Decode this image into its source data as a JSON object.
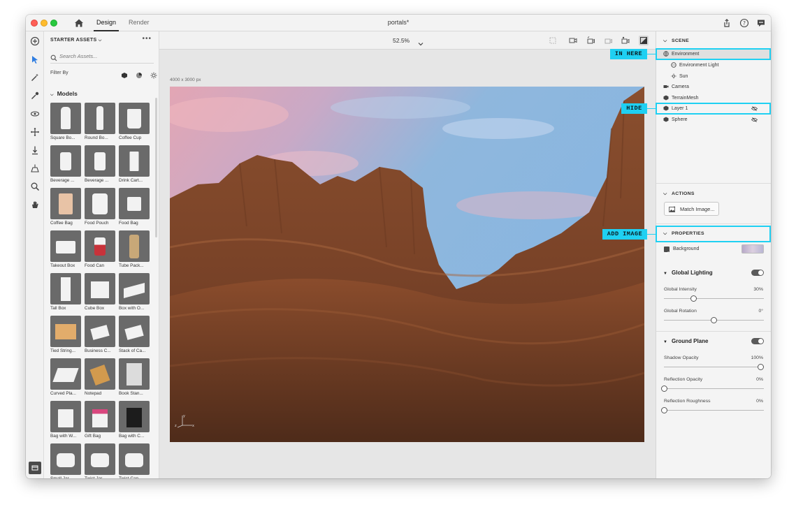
{
  "titlebar": {
    "tabs": [
      {
        "label": "Design"
      },
      {
        "label": "Render"
      }
    ],
    "document_title": "portals*"
  },
  "assets": {
    "header": "STARTER ASSETS",
    "more": "•••",
    "search_placeholder": "Search Assets...",
    "filter_label": "Filter By",
    "section": "Models",
    "items": [
      {
        "label": "Square Bo..."
      },
      {
        "label": "Round Bo..."
      },
      {
        "label": "Coffee Cup"
      },
      {
        "label": "Beverage ..."
      },
      {
        "label": "Beverage ..."
      },
      {
        "label": "Drink Cart..."
      },
      {
        "label": "Coffee Bag"
      },
      {
        "label": "Food Pouch"
      },
      {
        "label": "Food Bag"
      },
      {
        "label": "Takeout Box"
      },
      {
        "label": "Food Can"
      },
      {
        "label": "Tube Pack..."
      },
      {
        "label": "Tall Box"
      },
      {
        "label": "Cube Box"
      },
      {
        "label": "Box with O..."
      },
      {
        "label": "Tied String..."
      },
      {
        "label": "Business C..."
      },
      {
        "label": "Stack of Ca..."
      },
      {
        "label": "Curved Pla..."
      },
      {
        "label": "Notepad"
      },
      {
        "label": "Book Stan..."
      },
      {
        "label": "Bag with W..."
      },
      {
        "label": "Gift Bag"
      },
      {
        "label": "Bag with C..."
      },
      {
        "label": "Small Jar..."
      },
      {
        "label": "Twist Jar..."
      },
      {
        "label": "Twist Cap..."
      }
    ]
  },
  "canvas": {
    "zoom": "52.5%",
    "size_label": "4000 x 3000 px"
  },
  "scene": {
    "header": "SCENE",
    "items": [
      {
        "label": "Environment"
      },
      {
        "label": "Environment Light"
      },
      {
        "label": "Sun"
      },
      {
        "label": "Camera"
      },
      {
        "label": "TerrainMesh"
      },
      {
        "label": "Layer 1"
      },
      {
        "label": "Sphere"
      }
    ]
  },
  "actions": {
    "header": "ACTIONS",
    "match_image": "Match Image..."
  },
  "properties": {
    "header": "PROPERTIES",
    "background_label": "Background",
    "background_checked": true,
    "global_lighting": {
      "title": "Global Lighting",
      "enabled": true,
      "intensity_label": "Global Intensity",
      "intensity_value": "30%",
      "intensity_fraction": 0.3,
      "rotation_label": "Global Rotation",
      "rotation_value": "0°",
      "rotation_fraction": 0.5
    },
    "ground_plane": {
      "title": "Ground Plane",
      "enabled": true,
      "shadow_label": "Shadow Opacity",
      "shadow_value": "100%",
      "shadow_fraction": 1.0,
      "reflection_label": "Reflection Opacity",
      "reflection_value": "0%",
      "reflection_fraction": 0.0,
      "roughness_label": "Reflection Roughness",
      "roughness_value": "0%",
      "roughness_fraction": 0.0
    }
  },
  "annotations": {
    "in_here": "IN HERE",
    "hide": "HIDE",
    "add_image": "ADD IMAGE",
    "color": "#1fd0f2"
  }
}
